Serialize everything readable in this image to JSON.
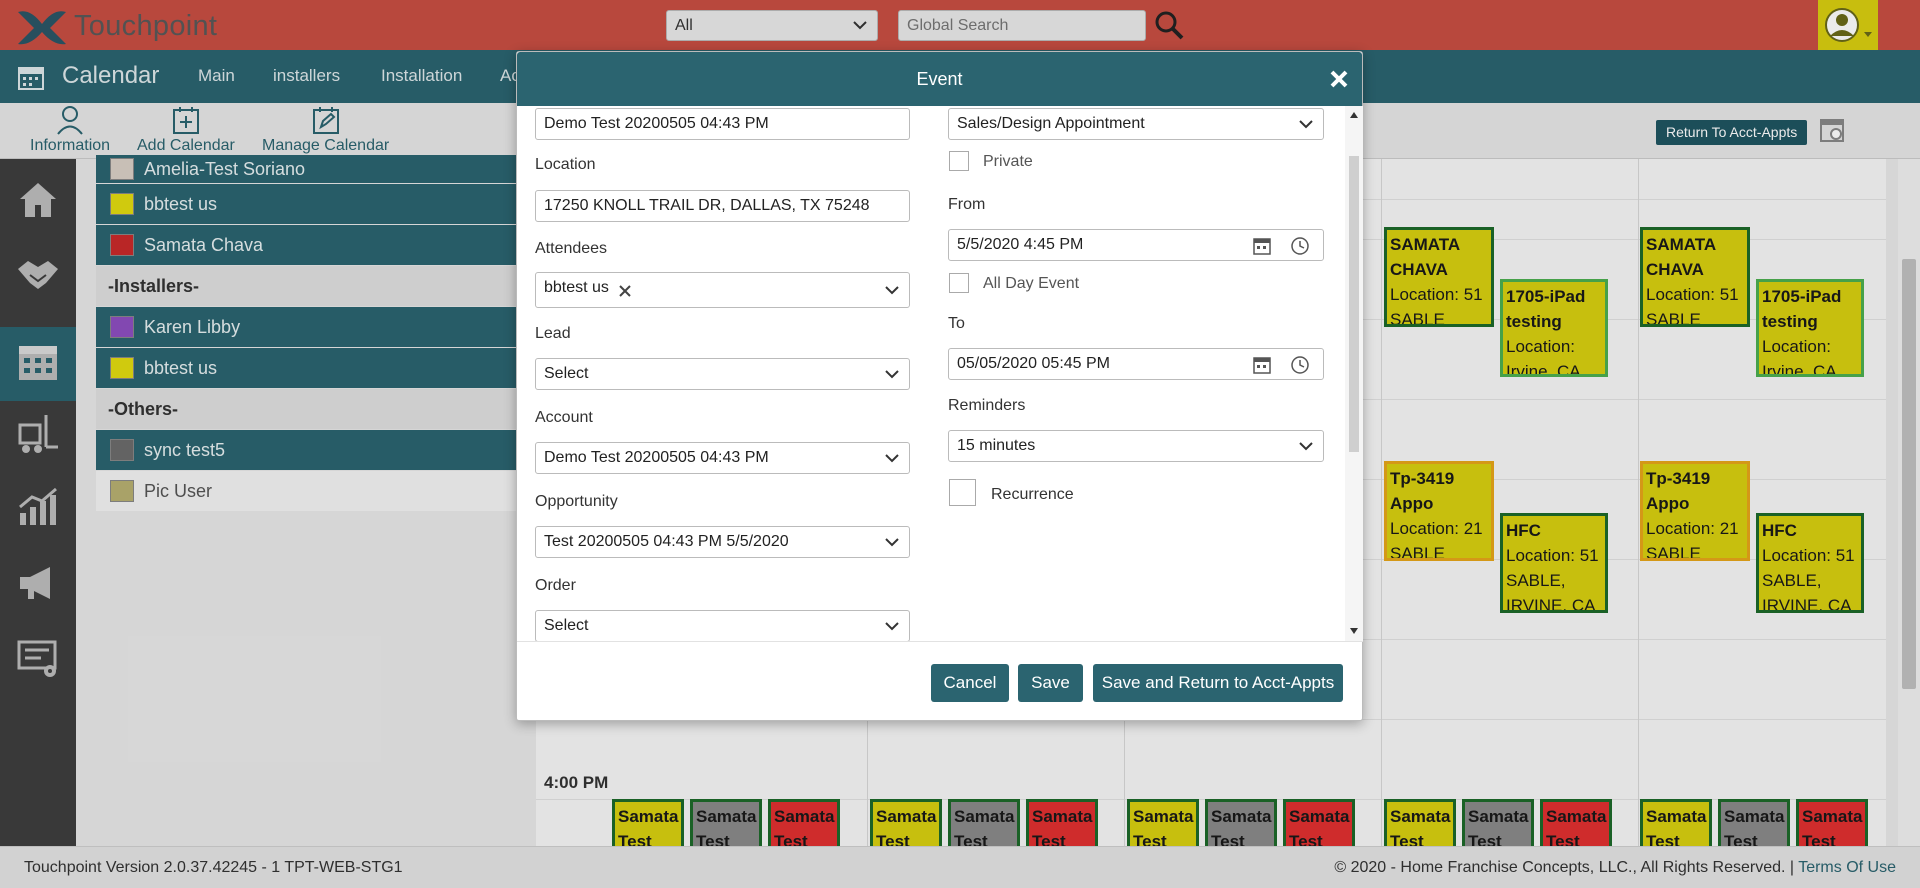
{
  "header": {
    "brand": "Touchpoint",
    "filter_select": "All",
    "search_placeholder": "Global Search"
  },
  "nav": {
    "title": "Calendar",
    "items": [
      "Main",
      "installers",
      "Installation",
      "Ac"
    ]
  },
  "toolbar": {
    "items": [
      "Information",
      "Add Calendar",
      "Manage Calendar"
    ],
    "return_button": "Return To Acct-Appts"
  },
  "calendars": {
    "rows": [
      {
        "label": "Amelia-Test Soriano",
        "color": "#d9d0c6"
      },
      {
        "label": "bbtest us",
        "color": "#e2dc10"
      },
      {
        "label": "Samata Chava",
        "color": "#c92a2a"
      }
    ],
    "group_installers": "-Installers-",
    "installers": [
      {
        "label": "Karen Libby",
        "color": "#8e4fc1"
      },
      {
        "label": "bbtest us",
        "color": "#e2dc10"
      }
    ],
    "group_others": "-Others-",
    "others": [
      {
        "label": "sync test5",
        "color": "#6c6c6c"
      },
      {
        "label": "Pic User",
        "color": "#b8b071"
      }
    ]
  },
  "grid": {
    "time_label": "4:00 PM",
    "events": {
      "samata_title": "SAMATA CHAVA",
      "samata_loc": "Location: 51 SABLE",
      "ipad_title": "1705-iPad testing",
      "ipad_loc": "Location: Irvine, CA",
      "tp_title": "Tp-3419 Appo",
      "tp_loc": "Location: 21 SABLE",
      "hfc_title": "HFC",
      "hfc_loc": "Location: 51 SABLE, IRVINE, CA",
      "bottom_title": "Samata Test"
    }
  },
  "modal": {
    "title": "Event",
    "subject_value": "Demo Test 20200505 04:43 PM",
    "location_label": "Location",
    "location_value": "17250 KNOLL TRAIL DR, DALLAS, TX 75248",
    "attendees_label": "Attendees",
    "attendees_tag": "bbtest us",
    "lead_label": "Lead",
    "lead_value": "Select",
    "account_label": "Account",
    "account_value": "Demo Test 20200505 04:43 PM",
    "opportunity_label": "Opportunity",
    "opportunity_value": "Test 20200505 04:43 PM 5/5/2020",
    "order_label": "Order",
    "order_value": "Select",
    "type_value": "Sales/Design Appointment",
    "private_label": "Private",
    "from_label": "From",
    "from_value": "5/5/2020 4:45 PM",
    "allday_label": "All Day Event",
    "to_label": "To",
    "to_value": "05/05/2020 05:45 PM",
    "reminders_label": "Reminders",
    "reminders_value": "15 minutes",
    "recurrence_label": "Recurrence",
    "cancel": "Cancel",
    "save": "Save",
    "save_return": "Save and Return to Acct-Appts"
  },
  "footer": {
    "version": "Touchpoint Version 2.0.37.42245 - 1 TPT-WEB-STG1",
    "copyright": "© 2020 - Home Franchise Concepts, LLC., All Rights Reserved. |",
    "terms": "Terms Of Use"
  }
}
